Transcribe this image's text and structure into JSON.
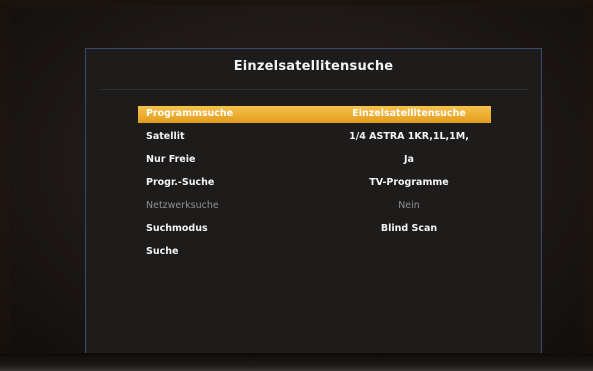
{
  "dialog": {
    "title": "Einzelsatellitensuche",
    "rows": [
      {
        "label": "Programmsuche",
        "value": "Einzelsatellitensuche",
        "selected": true,
        "enabled": true
      },
      {
        "label": "Satellit",
        "value": "1/4 ASTRA 1KR,1L,1M,",
        "selected": false,
        "enabled": true
      },
      {
        "label": "Nur Freie",
        "value": "Ja",
        "selected": false,
        "enabled": true
      },
      {
        "label": "Progr.-Suche",
        "value": "TV-Programme",
        "selected": false,
        "enabled": true
      },
      {
        "label": "Netzwerksuche",
        "value": "Nein",
        "selected": false,
        "enabled": false
      },
      {
        "label": "Suchmodus",
        "value": "Blind Scan",
        "selected": false,
        "enabled": true
      },
      {
        "label": "Suche",
        "value": "",
        "selected": false,
        "enabled": true
      }
    ]
  },
  "colors": {
    "highlight": "#f0b02e",
    "text": "#f4f4f4",
    "disabled_text": "#8f8f8f",
    "panel": "#1e1b1b"
  }
}
